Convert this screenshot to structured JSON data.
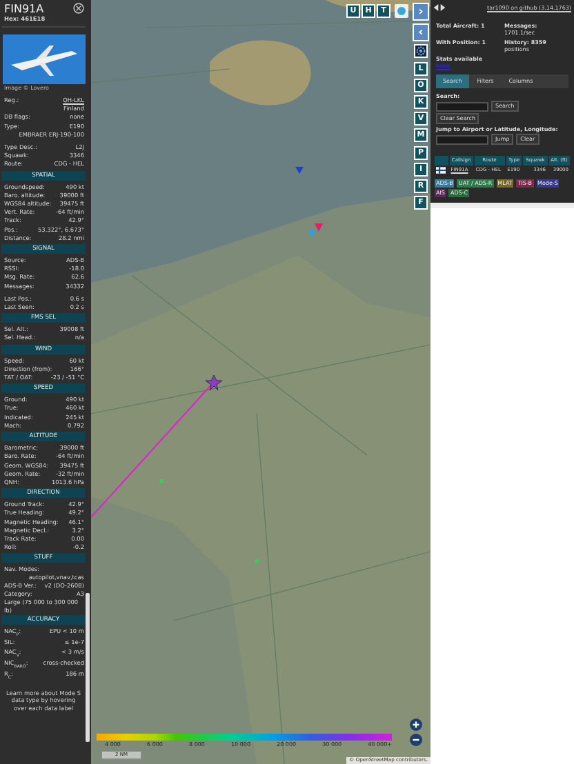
{
  "aircraft": {
    "callsign": "FIN91A",
    "hex": "Hex: 461E18",
    "photo_caption": "Image © Lovero",
    "sections": [
      {
        "rows": [
          {
            "kind": "link",
            "label": "Reg.:",
            "value": "OH-LKL"
          },
          {
            "kind": "line",
            "value": "Finland"
          },
          {
            "kind": "pair",
            "label": "DB flags:",
            "value": "none"
          },
          {
            "kind": "pair",
            "label": "Type:",
            "value": "E190"
          },
          {
            "kind": "line",
            "value": "EMBRAER ERJ-190-100"
          },
          {
            "kind": "gap"
          },
          {
            "kind": "pair",
            "label": "Type Desc.:",
            "value": "L2J"
          },
          {
            "kind": "pair",
            "label": "Squawk:",
            "value": "3346"
          },
          {
            "kind": "pair",
            "label": "Route:",
            "value": "CDG - HEL"
          }
        ]
      },
      {
        "title": "SPATIAL",
        "rows": [
          {
            "kind": "pair",
            "label": "Groundspeed:",
            "value": "490 kt"
          },
          {
            "kind": "pair",
            "label": "Baro. altitude:",
            "value": "39000 ft"
          },
          {
            "kind": "pair",
            "label": "WGS84 altitude:",
            "value": "39475 ft"
          },
          {
            "kind": "pair",
            "label": "Vert. Rate:",
            "value": "-64 ft/min"
          },
          {
            "kind": "pair",
            "label": "Track:",
            "value": "42.9°"
          },
          {
            "kind": "pair",
            "label": "Pos.:",
            "value": "53.322°, 6.673°"
          },
          {
            "kind": "pair",
            "label": "Distance:",
            "value": "28.2 nmi"
          }
        ]
      },
      {
        "title": "SIGNAL",
        "rows": [
          {
            "kind": "pair",
            "label": "Source:",
            "value": "ADS-B"
          },
          {
            "kind": "pair",
            "label": "RSSI:",
            "value": "-18.0"
          },
          {
            "kind": "pair",
            "label": "Msg. Rate:",
            "value": "62.6"
          },
          {
            "kind": "pair",
            "label": "Messages:",
            "value": "34332"
          },
          {
            "kind": "gap"
          },
          {
            "kind": "pair",
            "label": "Last Pos.:",
            "value": "0.6 s"
          },
          {
            "kind": "pair",
            "label": "Last Seen:",
            "value": "0.2 s"
          }
        ]
      },
      {
        "title": "FMS SEL",
        "rows": [
          {
            "kind": "pair",
            "label": "Sel. Alt.:",
            "value": "39008 ft"
          },
          {
            "kind": "pair",
            "label": "Sel. Head.:",
            "value": "n/a"
          }
        ]
      },
      {
        "title": "WIND",
        "rows": [
          {
            "kind": "pair",
            "label": "Speed:",
            "value": "60 kt"
          },
          {
            "kind": "pair",
            "label": "Direction (from):",
            "value": "166°"
          },
          {
            "kind": "pair",
            "label": "TAT / OAT:",
            "value": "-23 / -51 °C"
          }
        ]
      },
      {
        "title": "SPEED",
        "rows": [
          {
            "kind": "pair",
            "label": "Ground:",
            "value": "490 kt"
          },
          {
            "kind": "pair",
            "label": "True:",
            "value": "460 kt"
          },
          {
            "kind": "pair",
            "label": "Indicated:",
            "value": "245 kt"
          },
          {
            "kind": "pair",
            "label": "Mach:",
            "value": "0.792"
          }
        ]
      },
      {
        "title": "ALTITUDE",
        "rows": [
          {
            "kind": "pair",
            "label": "Barometric:",
            "value": "39000 ft"
          },
          {
            "kind": "pair",
            "label": "Baro. Rate:",
            "value": "-64 ft/min"
          },
          {
            "kind": "pair",
            "label": "Geom. WGS84:",
            "value": "39475 ft"
          },
          {
            "kind": "pair",
            "label": "Geom. Rate:",
            "value": "-32 ft/min"
          },
          {
            "kind": "pair",
            "label": "QNH:",
            "value": "1013.6 hPa"
          }
        ]
      },
      {
        "title": "DIRECTION",
        "rows": [
          {
            "kind": "pair",
            "label": "Ground Track:",
            "value": "42.9°"
          },
          {
            "kind": "pair",
            "label": "True Heading:",
            "value": "49.2°"
          },
          {
            "kind": "pair",
            "label": "Magnetic Heading:",
            "value": "46.1°"
          },
          {
            "kind": "pair",
            "label": "Magnetic Decl.:",
            "value": "3.2°"
          },
          {
            "kind": "pair",
            "label": "Track Rate:",
            "value": "0.00"
          },
          {
            "kind": "pair",
            "label": "Roll:",
            "value": "-0.2"
          }
        ]
      },
      {
        "title": "STUFF",
        "rows": [
          {
            "kind": "note",
            "value": "Nav. Modes:"
          },
          {
            "kind": "line",
            "value": "autopilot,vnav,tcas"
          },
          {
            "kind": "pair",
            "label": "ADS-B Ver.:",
            "value": "v2 (DO-260B)"
          },
          {
            "kind": "pair",
            "label": "Category:",
            "value": "A3"
          },
          {
            "kind": "note",
            "value": "Large (75 000 to 300 000 lb)"
          }
        ]
      },
      {
        "title": "ACCURACY",
        "rows": [
          {
            "kind": "pair",
            "label": "NAC$_{P}$:",
            "value": "EPU < 10 m"
          },
          {
            "kind": "pair",
            "label": "SIL:",
            "value": "≤ 1e-7"
          },
          {
            "kind": "pair",
            "label": "NAC$_{V}$:",
            "value": "< 3 m/s"
          },
          {
            "kind": "pair",
            "label": "NIC$_{BARO}$:",
            "value": "cross-checked"
          },
          {
            "kind": "pair",
            "label": "R$_{C}$:",
            "value": "186 m"
          }
        ]
      }
    ],
    "footer": "Learn more about Mode S data type by hovering over each data label"
  },
  "map": {
    "top_buttons": [
      "U",
      "H",
      "T"
    ],
    "side_buttons": [
      {
        "kind": "icon",
        "label": "›"
      },
      {
        "kind": "icon",
        "label": "‹"
      },
      {
        "kind": "gear"
      },
      {
        "kind": "letter",
        "label": "L"
      },
      {
        "kind": "letter",
        "label": "O"
      },
      {
        "kind": "letter",
        "label": "K"
      },
      {
        "kind": "letter",
        "label": "V"
      },
      {
        "kind": "letter",
        "label": "M"
      },
      {
        "kind": "letter",
        "label": "P"
      },
      {
        "kind": "letter",
        "label": "I"
      },
      {
        "kind": "letter",
        "label": "R"
      },
      {
        "kind": "letter",
        "label": "F"
      }
    ],
    "legend": [
      "4 000",
      "6 000",
      "8 000",
      "10 000",
      "20 000",
      "30 000",
      "40 000+"
    ],
    "scale": "2 NM",
    "attribution": "© OpenStreetMap contributors."
  },
  "panel": {
    "version_link": "tar1090 on github (3.14.1763)",
    "stats": [
      {
        "label": "Total Aircraft: 1"
      },
      {
        "label": "Messages:",
        "value": "1701.1/sec"
      },
      {
        "label": "With Position: 1"
      },
      {
        "label": "History: 8359",
        "value": "positions"
      }
    ],
    "stats_note": "Stats available",
    "stats_link": "here",
    "tabs": [
      {
        "label": "Search",
        "selected": true
      },
      {
        "label": "Filters",
        "selected": false
      },
      {
        "label": "Columns",
        "selected": false
      }
    ],
    "search_label": "Search:",
    "search_button": "Search",
    "clear_search": "Clear Search",
    "jump_label": "Jump to Airport or Latitude, Longitude:",
    "jump_button": "Jump",
    "clear_button": "Clear",
    "table": {
      "columns": [
        "Callsign",
        "Route",
        "Type",
        "Squawk",
        "Alt. (ft)"
      ],
      "rows": [
        [
          "FIN91A",
          "CDG - HEL",
          "E190",
          "3346",
          "39000"
        ]
      ]
    },
    "badges": [
      {
        "label": "ADS-B",
        "color": "#3a7a9a"
      },
      {
        "label": "UAT / ADS-R",
        "color": "#2f7a4a"
      },
      {
        "label": "MLAT",
        "color": "#7a6a2a"
      },
      {
        "label": "TIS-B",
        "color": "#7a2a4a"
      },
      {
        "label": "Mode-S",
        "color": "#3a3a8a"
      },
      {
        "label": "AIS",
        "color": "#5a2a5a"
      },
      {
        "label": "ADS-C",
        "color": "#2a6a3a"
      }
    ]
  }
}
